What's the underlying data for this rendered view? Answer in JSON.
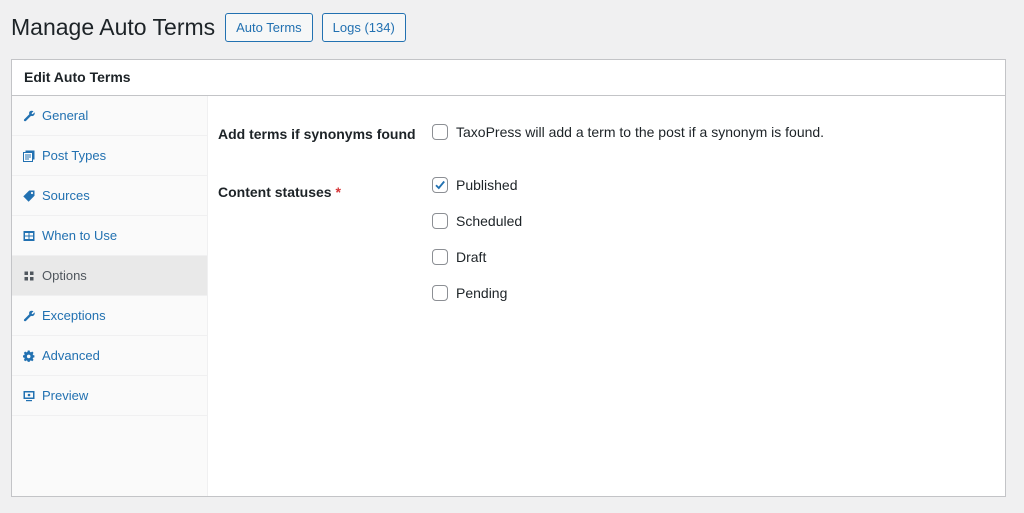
{
  "header": {
    "title": "Manage Auto Terms",
    "buttons": [
      {
        "label": "Auto Terms"
      },
      {
        "label": "Logs (134)"
      }
    ]
  },
  "panel": {
    "title": "Edit Auto Terms"
  },
  "sidebar": {
    "items": [
      {
        "label": "General",
        "icon": "wrench-icon",
        "active": false
      },
      {
        "label": "Post Types",
        "icon": "post-types-icon",
        "active": false
      },
      {
        "label": "Sources",
        "icon": "tag-icon",
        "active": false
      },
      {
        "label": "When to Use",
        "icon": "schedule-icon",
        "active": false
      },
      {
        "label": "Options",
        "icon": "grid-icon",
        "active": true
      },
      {
        "label": "Exceptions",
        "icon": "wrench-icon",
        "active": false
      },
      {
        "label": "Advanced",
        "icon": "gear-icon",
        "active": false
      },
      {
        "label": "Preview",
        "icon": "monitor-icon",
        "active": false
      }
    ]
  },
  "settings": {
    "synonyms": {
      "label": "Add terms if synonyms found",
      "description": "TaxoPress will add a term to the post if a synonym is found.",
      "checked": false
    },
    "statuses": {
      "label": "Content statuses",
      "required_mark": "*",
      "options": [
        {
          "label": "Published",
          "checked": true
        },
        {
          "label": "Scheduled",
          "checked": false
        },
        {
          "label": "Draft",
          "checked": false
        },
        {
          "label": "Pending",
          "checked": false
        }
      ]
    }
  },
  "colors": {
    "accent": "#2271b1",
    "required": "#d63638",
    "background": "#f0f0f1"
  }
}
